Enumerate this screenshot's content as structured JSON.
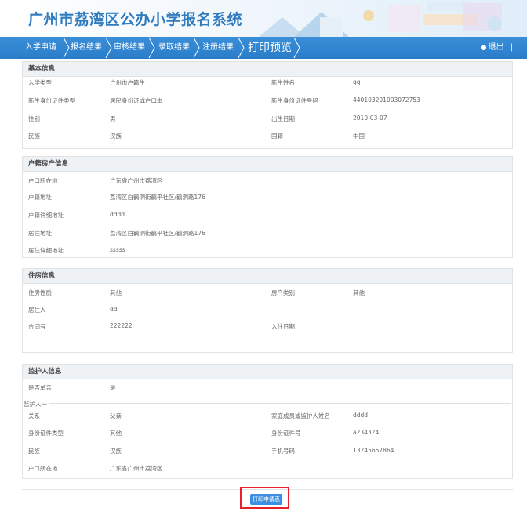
{
  "app": {
    "title": "广州市荔湾区公办小学报名系统"
  },
  "nav": {
    "tabs": [
      {
        "label": "入学申请"
      },
      {
        "label": "报名结果"
      },
      {
        "label": "审核结果"
      },
      {
        "label": "录取结果"
      },
      {
        "label": "注册结果"
      },
      {
        "label": "打印预览"
      }
    ],
    "logout": "退出",
    "separator": "|"
  },
  "basic": {
    "title": "基本信息",
    "rows": [
      {
        "label": "入学类型",
        "value": "广州市户籍生",
        "label2": "新生姓名",
        "value2": "qq"
      },
      {
        "label": "新生身份证件类型",
        "value": "居民身份证或户口本",
        "label2": "新生身份证件号码",
        "value2": "440103201003072753"
      },
      {
        "label": "性别",
        "value": "男",
        "label2": "出生日期",
        "value2": "2010-03-07"
      },
      {
        "label": "民族",
        "value": "汉族",
        "label2": "国籍",
        "value2": "中国"
      }
    ]
  },
  "household": {
    "title": "户籍房产信息",
    "rows": [
      {
        "label": "户口所在地",
        "value": "广东省广州市荔湾区"
      },
      {
        "label": "户籍地址",
        "value": "荔湾区白鹤洞街鹤平社区/鹤洞路176"
      },
      {
        "label": "户籍详细地址",
        "value": "dddd"
      },
      {
        "label": "居住地址",
        "value": "荔湾区白鹤洞街鹤平社区/鹤洞路176"
      },
      {
        "label": "居住详细地址",
        "value": "sssss"
      }
    ]
  },
  "housing": {
    "title": "住房信息",
    "rows": [
      {
        "label": "住房性质",
        "value": "其他",
        "label2": "房产类别",
        "value2": "其他"
      },
      {
        "label": "居住人",
        "value": "dd"
      },
      {
        "label": "合同号",
        "value": "222222",
        "label2": "入住日期",
        "value2": ""
      }
    ]
  },
  "guardian": {
    "title": "监护人信息",
    "single_parent_label": "是否单亲",
    "single_parent_value": "是",
    "sub_title": "监护人一",
    "rows": [
      {
        "label": "关系",
        "value": "父亲",
        "label2": "家庭成员或监护人姓名",
        "value2": "dddd"
      },
      {
        "label": "身份证件类型",
        "value": "其他",
        "label2": "身份证件号",
        "value2": "a234324"
      },
      {
        "label": "民族",
        "value": "汉族",
        "label2": "手机号码",
        "value2": "13245657864"
      },
      {
        "label": "户口所在地",
        "value": "广东省广州市荔湾区"
      }
    ]
  },
  "actions": {
    "print_label": "打印申请表"
  },
  "colors": {
    "accent": "#2a7cc8",
    "title": "#2f7bbf",
    "highlight": "#e8202a"
  }
}
